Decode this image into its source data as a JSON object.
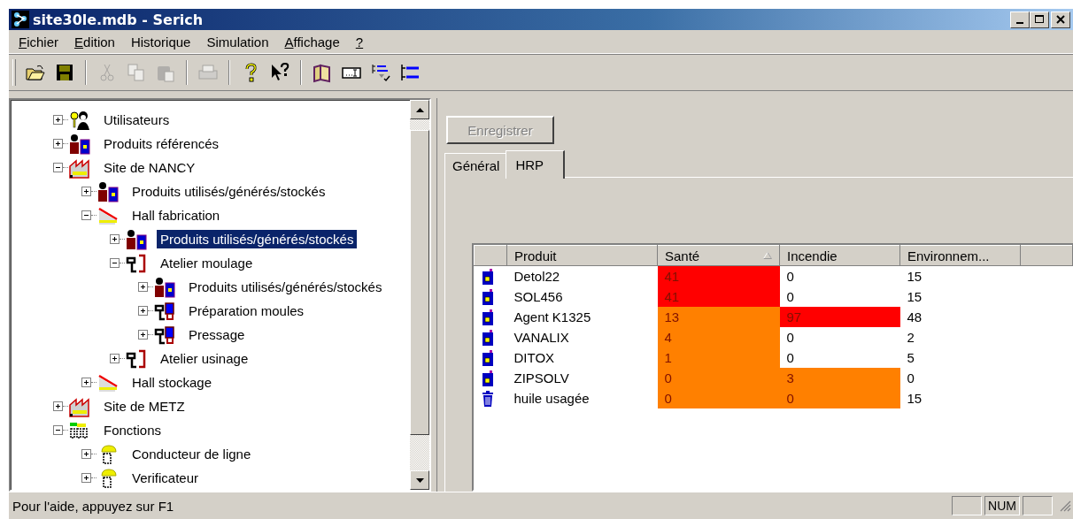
{
  "window": {
    "title": "site30le.mdb - Serich"
  },
  "menu": [
    {
      "label": "Fichier",
      "underlined": true
    },
    {
      "label": "Edition",
      "underlined": true
    },
    {
      "label": "Historique",
      "underlined": false
    },
    {
      "label": "Simulation",
      "underlined": false
    },
    {
      "label": "Affichage",
      "underlined": true
    },
    {
      "label": "?",
      "underlined": true
    }
  ],
  "toolbar": [
    {
      "kind": "open",
      "disabled": false
    },
    {
      "kind": "save",
      "disabled": false
    },
    {
      "kind": "separator"
    },
    {
      "kind": "cut",
      "disabled": true
    },
    {
      "kind": "copy",
      "disabled": true
    },
    {
      "kind": "paste",
      "disabled": true
    },
    {
      "kind": "separator"
    },
    {
      "kind": "print",
      "disabled": true
    },
    {
      "kind": "separator"
    },
    {
      "kind": "help",
      "disabled": false
    },
    {
      "kind": "context-help",
      "disabled": false
    },
    {
      "kind": "separator"
    },
    {
      "kind": "book",
      "disabled": false
    },
    {
      "kind": "field",
      "disabled": false
    },
    {
      "kind": "list-check",
      "disabled": false
    },
    {
      "kind": "list",
      "disabled": false
    }
  ],
  "tree": [
    {
      "label": "Utilisateurs",
      "kind": "users",
      "expanded": false,
      "selected": false
    },
    {
      "label": "Produits référencés",
      "kind": "products",
      "expanded": false,
      "selected": false
    },
    {
      "label": "Site de NANCY",
      "kind": "site",
      "expanded": true,
      "selected": false,
      "children": [
        {
          "label": "Produits utilisés/générés/stockés",
          "kind": "products",
          "expanded": false,
          "selected": false
        },
        {
          "label": "Hall fabrication",
          "kind": "hall",
          "expanded": true,
          "selected": false,
          "children": [
            {
              "label": "Produits utilisés/générés/stockés",
              "kind": "products",
              "expanded": false,
              "selected": true
            },
            {
              "label": "Atelier moulage",
              "kind": "workshop",
              "expanded": true,
              "selected": false,
              "children": [
                {
                  "label": "Produits utilisés/générés/stockés",
                  "kind": "products",
                  "expanded": false,
                  "selected": false
                },
                {
                  "label": "Préparation moules",
                  "kind": "station",
                  "expanded": false,
                  "selected": false
                },
                {
                  "label": "Pressage",
                  "kind": "station",
                  "expanded": false,
                  "selected": false
                }
              ]
            },
            {
              "label": "Atelier usinage",
              "kind": "workshop",
              "expanded": false,
              "selected": false
            }
          ]
        },
        {
          "label": "Hall stockage",
          "kind": "hall",
          "expanded": false,
          "selected": false
        }
      ]
    },
    {
      "label": "Site de METZ",
      "kind": "site",
      "expanded": false,
      "selected": false
    },
    {
      "label": "Fonctions",
      "kind": "functions",
      "expanded": true,
      "selected": false,
      "children": [
        {
          "label": "Conducteur de ligne",
          "kind": "person",
          "expanded": false,
          "selected": false
        },
        {
          "label": "Verificateur",
          "kind": "person",
          "expanded": false,
          "selected": false
        }
      ]
    }
  ],
  "save_button": {
    "label": "Enregistrer",
    "disabled": true
  },
  "tabs": [
    {
      "label": "Général",
      "selected": false
    },
    {
      "label": "HRP",
      "selected": true
    }
  ],
  "table": {
    "columns": [
      {
        "label": "Produit",
        "sorted": false
      },
      {
        "label": "Santé",
        "sorted": true
      },
      {
        "label": "Incendie",
        "sorted": false
      },
      {
        "label": "Environnem...",
        "sorted": false
      }
    ],
    "rows": [
      {
        "kind": "product",
        "cells": [
          {
            "text": "Detol22"
          },
          {
            "text": "41",
            "color": "#ff0000"
          },
          {
            "text": "0"
          },
          {
            "text": "15"
          }
        ]
      },
      {
        "kind": "product",
        "cells": [
          {
            "text": "SOL456"
          },
          {
            "text": "41",
            "color": "#ff0000"
          },
          {
            "text": "0"
          },
          {
            "text": "15"
          }
        ]
      },
      {
        "kind": "product",
        "cells": [
          {
            "text": "Agent K1325"
          },
          {
            "text": "13",
            "color": "#ff8000"
          },
          {
            "text": "97",
            "color": "#ff0000"
          },
          {
            "text": "48"
          }
        ]
      },
      {
        "kind": "product",
        "cells": [
          {
            "text": "VANALIX"
          },
          {
            "text": "4",
            "color": "#ff8000"
          },
          {
            "text": "0"
          },
          {
            "text": "2"
          }
        ]
      },
      {
        "kind": "product",
        "cells": [
          {
            "text": "DITOX"
          },
          {
            "text": "1",
            "color": "#ff8000"
          },
          {
            "text": "0"
          },
          {
            "text": "5"
          }
        ]
      },
      {
        "kind": "product",
        "cells": [
          {
            "text": "ZIPSOLV"
          },
          {
            "text": "0",
            "color": "#ff8000"
          },
          {
            "text": "3",
            "color": "#ff8000"
          },
          {
            "text": "0"
          }
        ]
      },
      {
        "kind": "waste",
        "cells": [
          {
            "text": "huile usagée"
          },
          {
            "text": "0",
            "color": "#ff8000"
          },
          {
            "text": "0",
            "color": "#ff8000"
          },
          {
            "text": "15"
          }
        ]
      }
    ]
  },
  "status_bar": {
    "text": "Pour l'aide, appuyez sur F1",
    "indicator": "NUM"
  }
}
